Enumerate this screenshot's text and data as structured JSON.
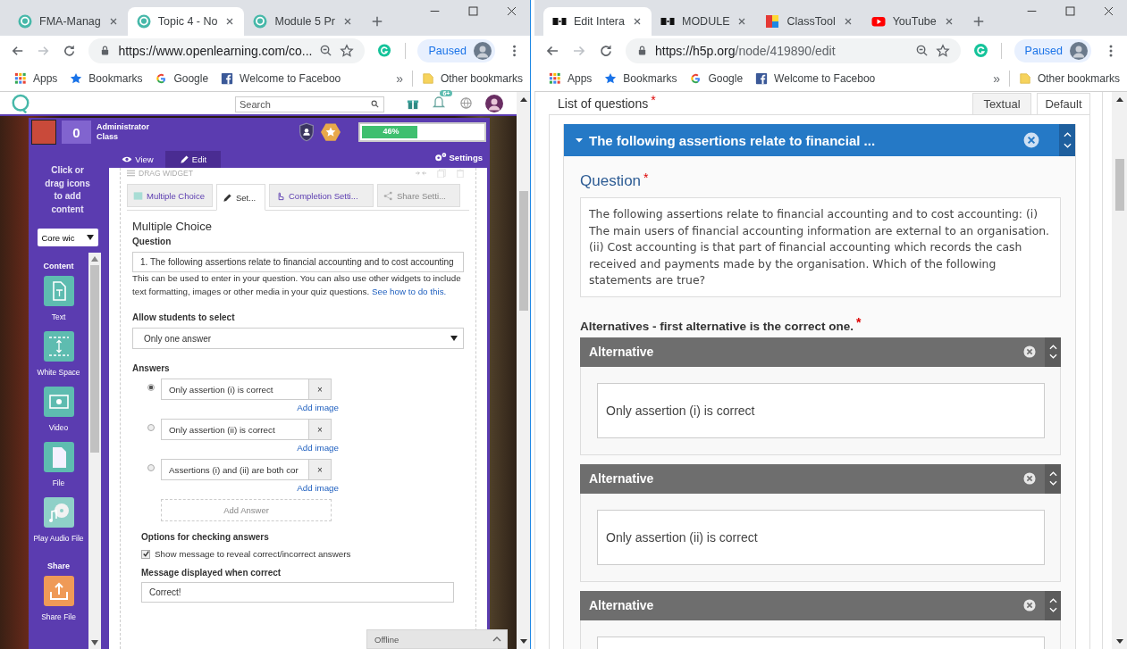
{
  "left_browser": {
    "tabs": [
      {
        "label": "FMA-Manag",
        "kind": "openlearning",
        "selected": false
      },
      {
        "label": "Topic 4 - No",
        "kind": "openlearning",
        "selected": true
      },
      {
        "label": "Module 5 Pr",
        "kind": "openlearning",
        "selected": false
      }
    ],
    "address": "https://www.openlearning.com/co...",
    "profile": "Paused",
    "bookmarks": [
      {
        "label": "Apps",
        "kind": "apps"
      },
      {
        "label": "Bookmarks",
        "kind": "star"
      },
      {
        "label": "Google",
        "kind": "google"
      },
      {
        "label": "Welcome to Faceboo",
        "kind": "facebook"
      }
    ],
    "overflow": "»",
    "other_bookmarks": "Other bookmarks"
  },
  "openlearning_page": {
    "site_bar": {
      "search_placeholder": "Search",
      "notification_badge": "6+"
    },
    "course_header": {
      "points": "0",
      "role": "Administrator",
      "group": "Class",
      "progress_label": "46%",
      "level": 0.46
    },
    "mode_tabs": [
      {
        "label": "View",
        "kind": "eye",
        "selected": false
      },
      {
        "label": "Edit",
        "kind": "pencil",
        "selected": true
      }
    ],
    "settings": "Settings",
    "sidebar": {
      "hint": "Click or drag icons to add content",
      "category": "Core wic",
      "sections": [
        {
          "title": "Content",
          "items": [
            {
              "label": "Text",
              "kind": "text"
            },
            {
              "label": "White Space",
              "kind": "space"
            },
            {
              "label": "Video",
              "kind": "video"
            },
            {
              "label": "File",
              "kind": "file"
            },
            {
              "label": "Play Audio File",
              "kind": "audio"
            }
          ]
        },
        {
          "title": "Share",
          "items": [
            {
              "label": "Share File",
              "kind": "share"
            }
          ]
        }
      ]
    },
    "widget": {
      "handle": "DRAG WIDGET",
      "tabs": [
        {
          "label": "Multiple Choice",
          "kind": "list",
          "selected": false,
          "disabled": false
        },
        {
          "label": "Set...",
          "kind": "pencil",
          "selected": true,
          "disabled": false
        },
        {
          "label": "Completion Setti...",
          "kind": "pointer",
          "selected": false,
          "disabled": false
        },
        {
          "label": "Share Setti...",
          "kind": "share",
          "selected": false,
          "disabled": true
        }
      ],
      "title": "Multiple Choice",
      "question_label": "Question",
      "question_value": "1. The following assertions relate to financial accounting and to cost accounting",
      "help_text": "This can be used to enter in your question. You can also use other widgets to include text formatting, images or other media in your quiz questions.",
      "help_link": "See how to do this.",
      "select_label": "Allow students to select",
      "select_value": "Only one answer",
      "answers_label": "Answers",
      "answers": [
        {
          "value": "Only assertion (i) is correct",
          "selected": true,
          "remove": "×",
          "add_image": "Add image"
        },
        {
          "value": "Only assertion (ii) is correct",
          "selected": false,
          "remove": "×",
          "add_image": "Add image"
        },
        {
          "value": "Assertions (i) and (ii) are both cor",
          "selected": false,
          "remove": "×",
          "add_image": "Add image"
        }
      ],
      "add_answer": "Add Answer",
      "options_label": "Options for checking answers",
      "show_message": {
        "label": "Show message to reveal correct/incorrect answers",
        "checked": true
      },
      "correct_label": "Message displayed when correct",
      "correct_value": "Correct!"
    },
    "offline_panel": {
      "label": "Offline"
    }
  },
  "right_browser": {
    "tabs": [
      {
        "label": "Edit Intera",
        "kind": "h5p",
        "selected": true
      },
      {
        "label": "MODULE",
        "kind": "h5p",
        "selected": false
      },
      {
        "label": "ClassTool",
        "kind": "classtools",
        "selected": false
      },
      {
        "label": "YouTube",
        "kind": "youtube",
        "selected": false
      }
    ],
    "address_host": "https://h5p.org",
    "address_path": "/node/419890/edit",
    "profile": "Paused",
    "bookmarks": [
      {
        "label": "Apps",
        "kind": "apps"
      },
      {
        "label": "Bookmarks",
        "kind": "star"
      },
      {
        "label": "Google",
        "kind": "google"
      },
      {
        "label": "Welcome to Faceboo",
        "kind": "facebook"
      }
    ],
    "overflow": "»",
    "other_bookmarks": "Other bookmarks"
  },
  "h5p_page": {
    "list_label": "List of questions",
    "required_mark": "*",
    "view_tabs": [
      {
        "label": "Textual",
        "selected": false
      },
      {
        "label": "Default",
        "selected": true
      }
    ],
    "question_group": {
      "title": "The following assertions relate to financial ...",
      "expanded": true,
      "field_label": "Question",
      "field_required_mark": "*",
      "text": "The following assertions relate to financial accounting and to cost accounting: (i) The main users of financial accounting information are external to an organisation. (ii) Cost accounting is that part of financial accounting which records the cash received and payments made by the organisation. Which of the following statements are true?",
      "alternatives_label": "Alternatives - first alternative is the correct one.",
      "alternatives_required_mark": "*",
      "alternatives": [
        {
          "title": "Alternative",
          "value": "Only assertion (i) is correct"
        },
        {
          "title": "Alternative",
          "value": "Only assertion (ii) is correct"
        },
        {
          "title": "Alternative"
        }
      ]
    }
  }
}
